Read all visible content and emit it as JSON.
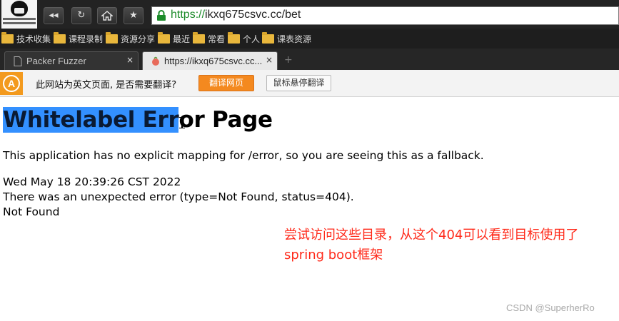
{
  "toolbar": {
    "logo_icon": "site-logo-icon",
    "back_icon": "rewind-icon",
    "reload_icon": "reload-icon",
    "home_icon": "home-icon",
    "bookmark_icon": "star-icon",
    "back_glyph": "◂◂",
    "reload_glyph": "↻",
    "star_glyph": "★",
    "url_secure": "https://",
    "url_rest": "ikxq675csvc.cc/bet",
    "accent_secure": "#1c8b2a"
  },
  "bookmarks": [
    {
      "label": "技术收集"
    },
    {
      "label": "课程录制"
    },
    {
      "label": "资源分享"
    },
    {
      "label": "最近"
    },
    {
      "label": "常看"
    },
    {
      "label": "个人"
    },
    {
      "label": "课表资源"
    }
  ],
  "tabs": [
    {
      "title": "Packer Fuzzer",
      "close": "×"
    },
    {
      "title": "https://ikxq675csvc.cc...",
      "close": "×"
    }
  ],
  "new_tab": "+",
  "translate_bar": {
    "icon_letter": "A",
    "message": "此网站为英文页面, 是否需要翻译?",
    "translate_button": "翻译网页",
    "hover_button": "鼠标悬停翻译",
    "accent": "#f4891f"
  },
  "page": {
    "title_selected": "Whitelabel Err",
    "title_rest": "or Page",
    "description": "This application has no explicit mapping for /error, so you are seeing this as a fallback.",
    "timestamp": "Wed May 18 20:39:26 CST 2022",
    "error_line": "There was an unexpected error (type=Not Found, status=404).",
    "not_found": "Not Found"
  },
  "annotation": "尝试访问这些目录，从这个404可以看到目标使用了spring boot框架",
  "watermark": "CSDN @SuperherRo"
}
